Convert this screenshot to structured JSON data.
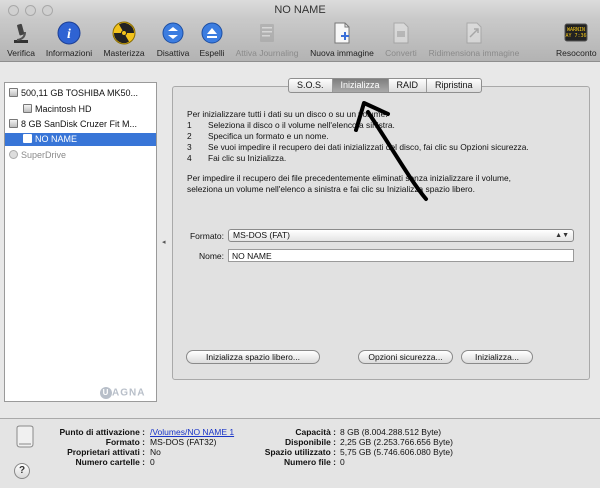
{
  "window": {
    "title": "NO NAME"
  },
  "toolbar": {
    "items": [
      {
        "label": "Verifica",
        "icon": "microscope-icon",
        "enabled": true
      },
      {
        "label": "Informazioni",
        "icon": "info-icon",
        "enabled": true
      },
      {
        "label": "Masterizza",
        "icon": "burn-icon",
        "enabled": true
      },
      {
        "label": "Disattiva",
        "icon": "unmount-icon",
        "enabled": true
      },
      {
        "label": "Espelli",
        "icon": "eject-icon",
        "enabled": true
      },
      {
        "label": "Attiva Journaling",
        "icon": "journaling-icon",
        "enabled": false
      },
      {
        "label": "Nuova immagine",
        "icon": "new-image-icon",
        "enabled": true
      },
      {
        "label": "Converti",
        "icon": "convert-icon",
        "enabled": false
      },
      {
        "label": "Ridimensiona immagine",
        "icon": "resize-image-icon",
        "enabled": false
      },
      {
        "label": "Resoconto",
        "icon": "log-icon",
        "enabled": true
      }
    ],
    "log_screen_text": "WARNIN\nAY 7:36"
  },
  "sidebar": {
    "items": [
      {
        "label": "500,11 GB TOSHIBA MK50...",
        "level": 0,
        "icon": "hard-disk-icon"
      },
      {
        "label": "Macintosh HD",
        "level": 1,
        "icon": "volume-icon"
      },
      {
        "label": "8 GB SanDisk Cruzer Fit M...",
        "level": 0,
        "icon": "usb-disk-icon"
      },
      {
        "label": "NO NAME",
        "level": 1,
        "icon": "volume-icon",
        "selected": true
      },
      {
        "label": "SuperDrive",
        "level": 0,
        "icon": "optical-drive-icon",
        "dimmed": true
      }
    ]
  },
  "tabs": [
    {
      "label": "S.O.S.",
      "active": false
    },
    {
      "label": "Inizializza",
      "active": true
    },
    {
      "label": "RAID",
      "active": false
    },
    {
      "label": "Ripristina",
      "active": false
    }
  ],
  "erase": {
    "intro": "Per inizializzare tutti i dati su un disco o su un volume:",
    "steps": [
      {
        "n": "1",
        "text": "Seleziona il disco o il volume nell'elenco a sinistra."
      },
      {
        "n": "2",
        "text": "Specifica un formato e un nome."
      },
      {
        "n": "3",
        "text": "Se vuoi impedire il recupero dei dati inizializzati del disco, fai clic su Opzioni sicurezza."
      },
      {
        "n": "4",
        "text": "Fai clic su Inizializza."
      }
    ],
    "free_space_1": "Per impedire il recupero dei file precedentemente eliminati senza inizializzare il volume,",
    "free_space_2": "seleziona un volume nell'elenco a sinistra e fai clic su Inizializza spazio libero.",
    "format_label": "Formato:",
    "format_value": "MS-DOS (FAT)",
    "name_label": "Nome:",
    "name_value": "NO NAME",
    "btn_free_space": "Inizializza spazio libero...",
    "btn_security": "Opzioni sicurezza...",
    "btn_erase": "Inizializza..."
  },
  "watermark": {
    "letter": "U",
    "rest": "AGNA"
  },
  "info": {
    "left": [
      {
        "key": "Punto di attivazione :",
        "value": "/Volumes/NO NAME 1",
        "link": true
      },
      {
        "key": "Formato :",
        "value": "MS-DOS (FAT32)"
      },
      {
        "key": "Proprietari attivati :",
        "value": "No"
      },
      {
        "key": "Numero cartelle :",
        "value": "0"
      }
    ],
    "right": [
      {
        "key": "Capacità :",
        "value": "8 GB (8.004.288.512 Byte)"
      },
      {
        "key": "Disponibile :",
        "value": "2,25 GB (2.253.766.656 Byte)"
      },
      {
        "key": "Spazio utilizzato :",
        "value": "5,75 GB (5.746.606.080 Byte)"
      },
      {
        "key": "Numero file :",
        "value": "0"
      }
    ]
  },
  "help": {
    "label": "?"
  }
}
